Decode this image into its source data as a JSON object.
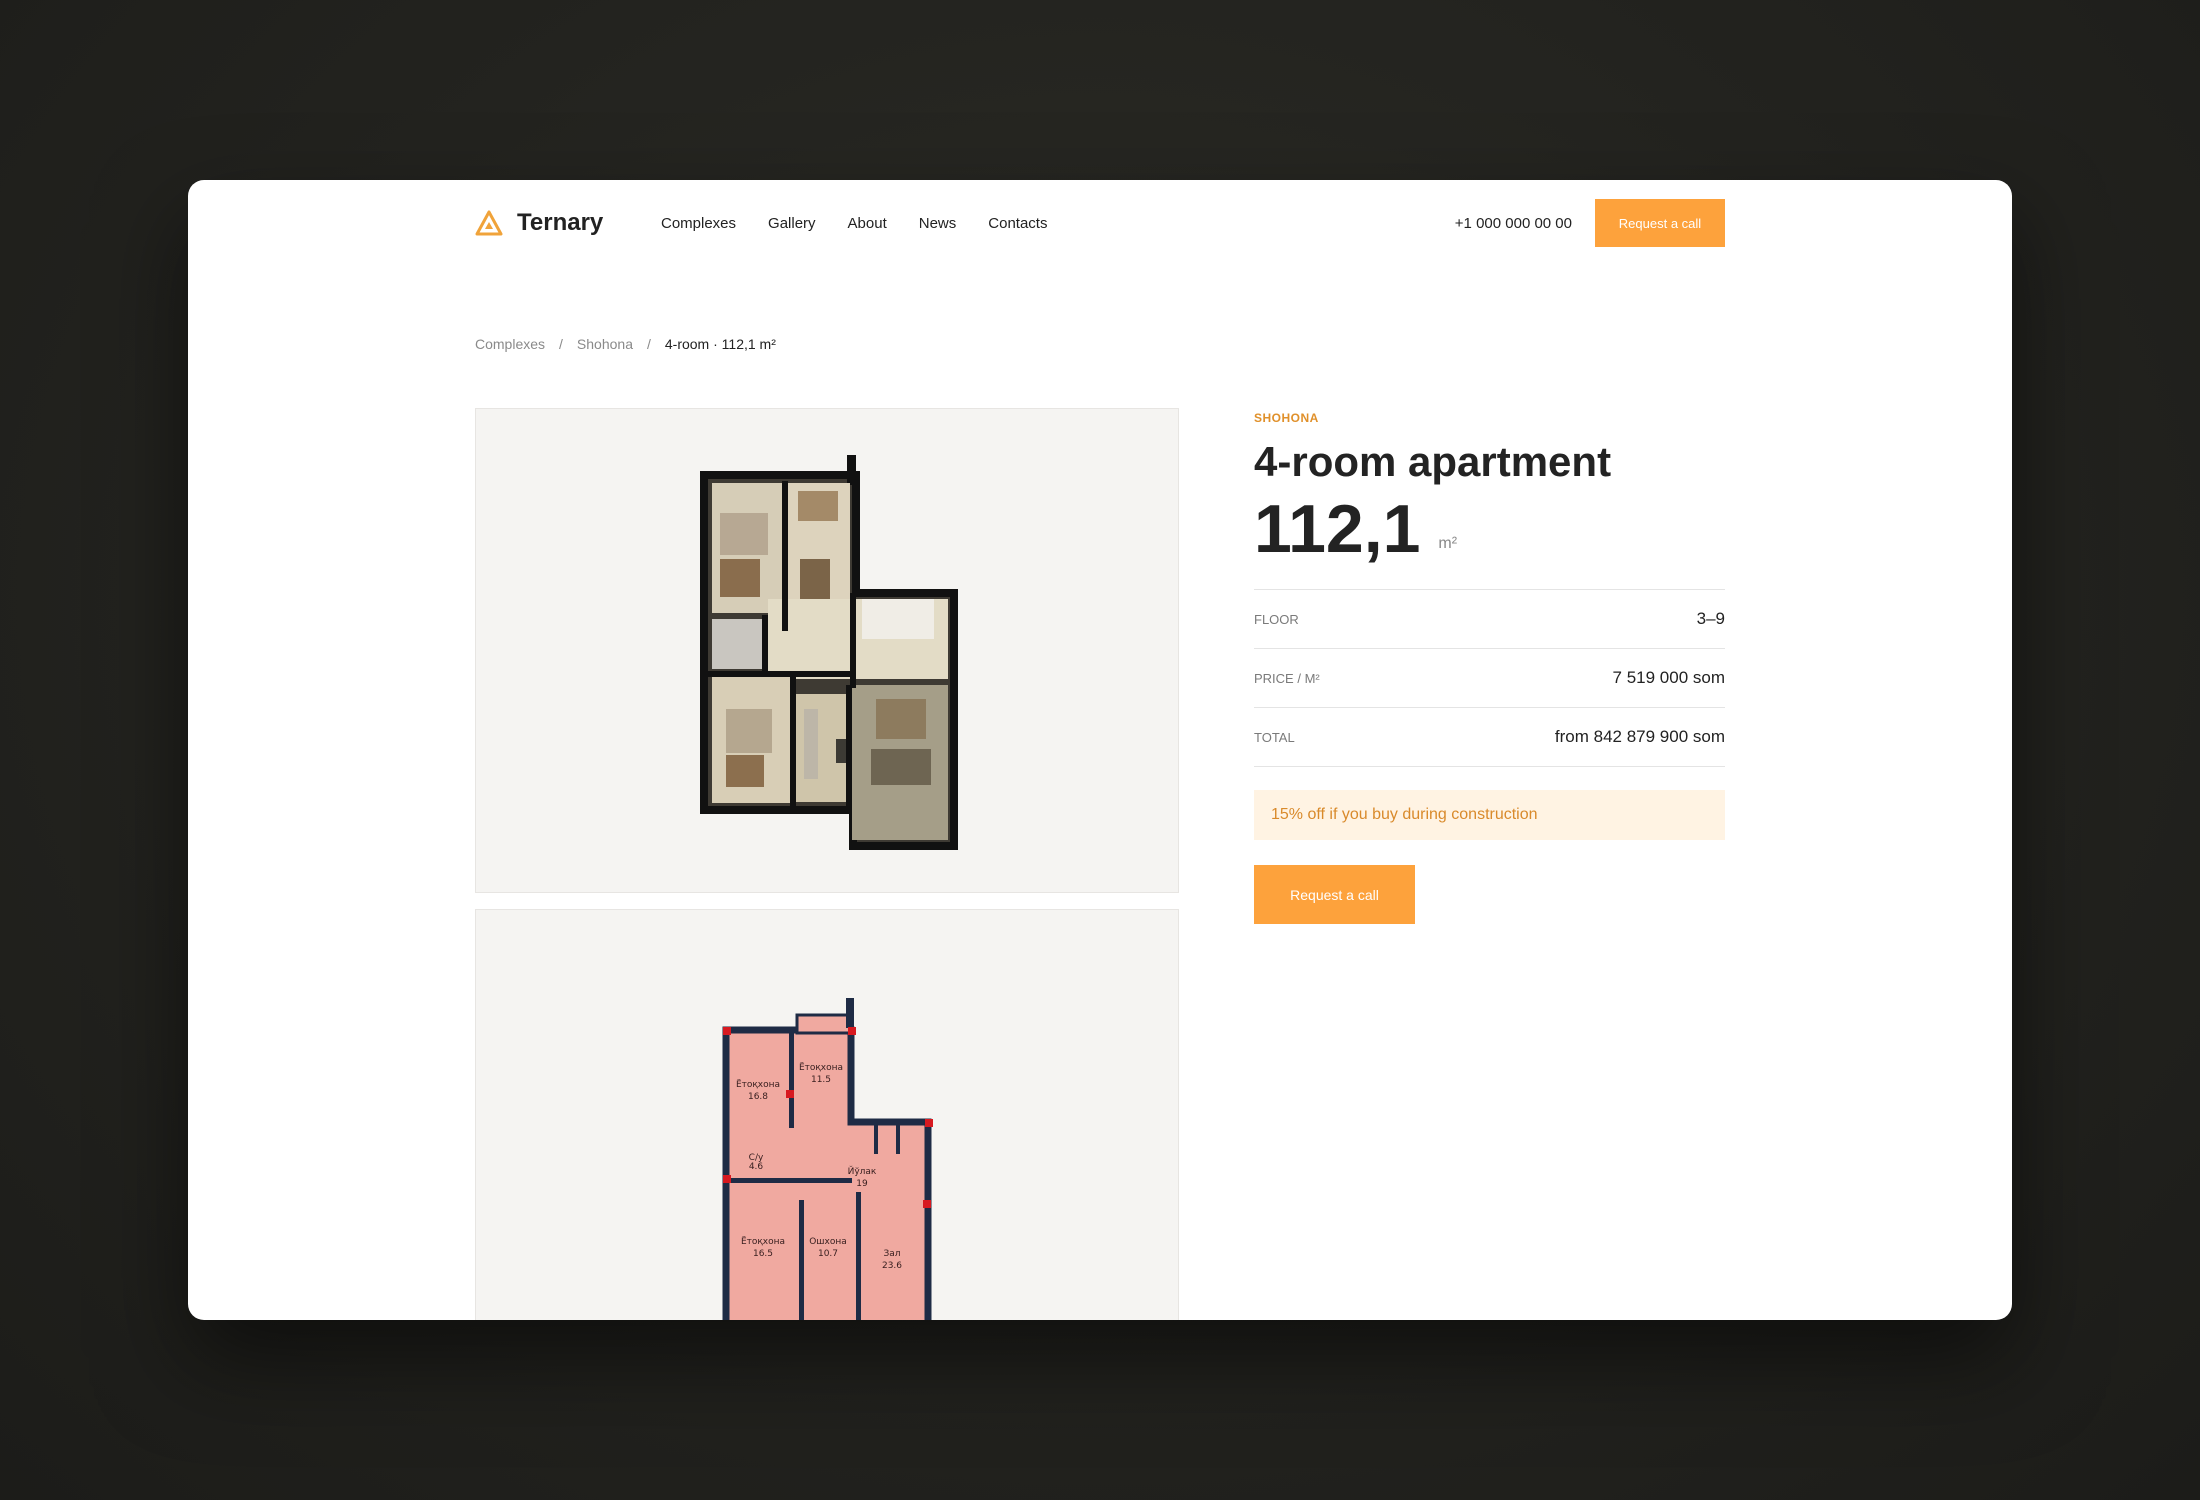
{
  "header": {
    "brand": "Ternary",
    "nav": [
      "Complexes",
      "Gallery",
      "About",
      "News",
      "Contacts"
    ],
    "phone": "+1 000 000 00 00",
    "cta_label": "Request a call"
  },
  "breadcrumb": {
    "items": [
      "Complexes",
      "Shohona",
      "4-room · 112,1 m²"
    ],
    "separator": "/"
  },
  "plans": {
    "room_labels": [
      {
        "name": "Ётоқхона",
        "area": "16.8"
      },
      {
        "name": "Ётоқхона",
        "area": "11.5"
      },
      {
        "name": "С/у",
        "area": "4.6"
      },
      {
        "name": "Йўлак",
        "area": "19"
      },
      {
        "name": "Ётоқхона",
        "area": "16.5"
      },
      {
        "name": "Ошхона",
        "area": "10.7"
      },
      {
        "name": "Зал",
        "area": "23.6"
      }
    ]
  },
  "apartment": {
    "complex": "SHOHONA",
    "title": "4-room apartment",
    "area_value": "112,1",
    "area_unit": "m²",
    "specs": [
      {
        "label": "FLOOR",
        "value": "3–9"
      },
      {
        "label": "PRICE / M²",
        "value": "7 519 000 som"
      },
      {
        "label": "TOTAL",
        "value": "from 842 879 900 som"
      }
    ],
    "promo": "15% off if you buy during construction",
    "cta_label": "Request a call"
  },
  "colors": {
    "accent": "#fda23c",
    "promo_bg": "#fff3e3",
    "promo_text": "#d98a2b",
    "plan_bg": "#f5f4f2",
    "plan_fill": "#f0a9a0"
  }
}
